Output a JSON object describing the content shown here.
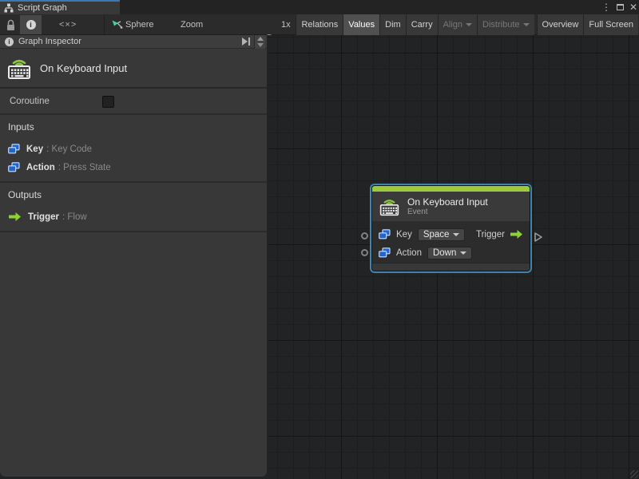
{
  "tab": {
    "title": "Script Graph"
  },
  "window_controls": {
    "menu_glyph": "⋮",
    "close_glyph": "✕"
  },
  "toolbar": {
    "code_glyph": "<×>",
    "target": "Sphere",
    "zoom_label": "Zoom",
    "zoom_level": "1x",
    "buttons": [
      {
        "label": "Relations",
        "state": "normal"
      },
      {
        "label": "Values",
        "state": "active"
      },
      {
        "label": "Dim",
        "state": "normal"
      },
      {
        "label": "Carry",
        "state": "normal"
      },
      {
        "label": "Align",
        "state": "disabled"
      },
      {
        "label": "Distribute",
        "state": "disabled"
      },
      {
        "label": "Overview",
        "state": "normal"
      },
      {
        "label": "Full Screen",
        "state": "normal"
      }
    ]
  },
  "inspector": {
    "title": "Graph Inspector",
    "unit_title": "On Keyboard Input",
    "coroutine_label": "Coroutine",
    "coroutine_checked": false,
    "inputs_header": "Inputs",
    "inputs": [
      {
        "name": "Key",
        "type": ": Key Code"
      },
      {
        "name": "Action",
        "type": ": Press State"
      }
    ],
    "outputs_header": "Outputs",
    "outputs": [
      {
        "name": "Trigger",
        "type": ": Flow"
      }
    ]
  },
  "node": {
    "title": "On Keyboard Input",
    "subtitle": "Event",
    "key_label": "Key",
    "key_value": "Space",
    "action_label": "Action",
    "action_value": "Down",
    "trigger_label": "Trigger"
  },
  "colors": {
    "accent_green": "#9bcb3a",
    "selection_blue": "#3f84ad",
    "port_blue": "#2266cc",
    "tab_accent": "#3d77b7",
    "canvas_bg": "#222324",
    "panel_bg": "#383838"
  }
}
